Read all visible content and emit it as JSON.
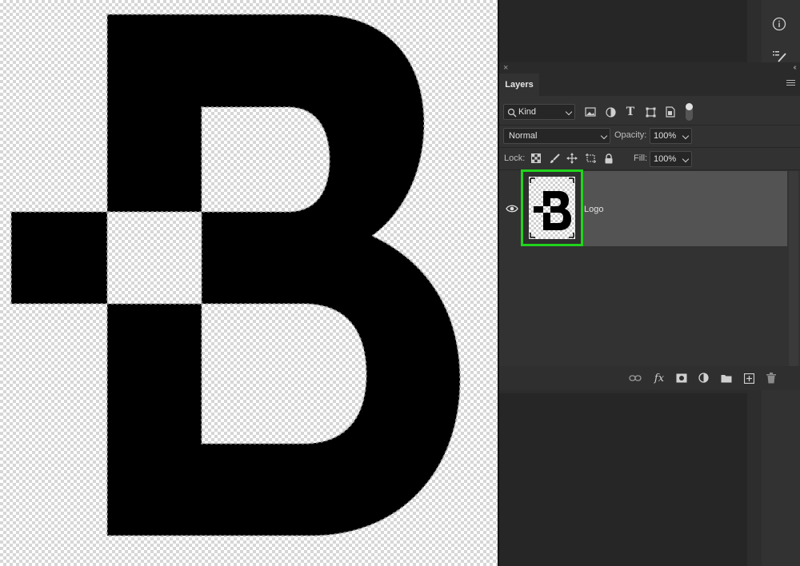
{
  "panel": {
    "tab_label": "Layers",
    "close_glyph": "×",
    "collapse_glyph": "‹‹",
    "filter": {
      "label": "Kind"
    },
    "blend_mode": "Normal",
    "opacity": {
      "label": "Opacity:",
      "value": "100%"
    },
    "lock": {
      "label": "Lock:"
    },
    "fill": {
      "label": "Fill:",
      "value": "100%"
    },
    "layers": [
      {
        "name": "Logo",
        "visible": true,
        "selected": true
      }
    ],
    "filter_icons": [
      "pixel-layer-filter-icon",
      "adjustment-layer-filter-icon",
      "type-layer-filter-icon",
      "shape-layer-filter-icon",
      "smart-object-filter-icon",
      "filter-toggle-icon"
    ],
    "lock_icons": [
      "lock-transparent-pixels-icon",
      "lock-image-pixels-icon",
      "lock-position-icon",
      "prevent-auto-nesting-icon",
      "lock-all-icon"
    ],
    "footer_icons": [
      "link-layers-icon",
      "fx-icon",
      "layer-mask-icon",
      "adjustment-layer-icon",
      "group-folder-icon",
      "new-layer-icon",
      "trash-icon"
    ],
    "fx_text": "fx"
  },
  "dock": {
    "icons": [
      "info-icon",
      "properties-icon"
    ]
  },
  "colors": {
    "selection_highlight": "#22d41c",
    "panel_bg": "#323232",
    "row_selected": "#535353"
  }
}
